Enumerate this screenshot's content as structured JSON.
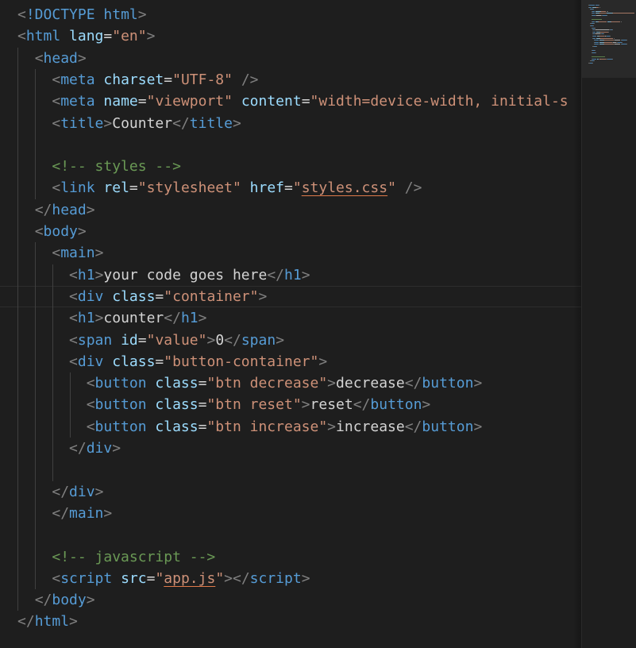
{
  "editor": {
    "language": "html",
    "lines": [
      [
        [
          "punct",
          "<"
        ],
        [
          "doctype",
          "!DOCTYPE"
        ],
        [
          "text",
          " "
        ],
        [
          "tag",
          "html"
        ],
        [
          "punct",
          ">"
        ]
      ],
      [
        [
          "punct",
          "<"
        ],
        [
          "tag",
          "html"
        ],
        [
          "text",
          " "
        ],
        [
          "attr",
          "lang"
        ],
        [
          "text",
          "="
        ],
        [
          "str",
          "\"en\""
        ],
        [
          "punct",
          ">"
        ]
      ],
      [
        [
          "text",
          "  "
        ],
        [
          "punct",
          "<"
        ],
        [
          "tag",
          "head"
        ],
        [
          "punct",
          ">"
        ]
      ],
      [
        [
          "text",
          "    "
        ],
        [
          "punct",
          "<"
        ],
        [
          "tag",
          "meta"
        ],
        [
          "text",
          " "
        ],
        [
          "attr",
          "charset"
        ],
        [
          "text",
          "="
        ],
        [
          "str",
          "\"UTF-8\""
        ],
        [
          "text",
          " "
        ],
        [
          "punct",
          "/>"
        ]
      ],
      [
        [
          "text",
          "    "
        ],
        [
          "punct",
          "<"
        ],
        [
          "tag",
          "meta"
        ],
        [
          "text",
          " "
        ],
        [
          "attr",
          "name"
        ],
        [
          "text",
          "="
        ],
        [
          "str",
          "\"viewport\""
        ],
        [
          "text",
          " "
        ],
        [
          "attr",
          "content"
        ],
        [
          "text",
          "="
        ],
        [
          "str",
          "\"width=device-width, initial-s"
        ]
      ],
      [
        [
          "text",
          "    "
        ],
        [
          "punct",
          "<"
        ],
        [
          "tag",
          "title"
        ],
        [
          "punct",
          ">"
        ],
        [
          "text",
          "Counter"
        ],
        [
          "punct",
          "</"
        ],
        [
          "tag",
          "title"
        ],
        [
          "punct",
          ">"
        ]
      ],
      [],
      [
        [
          "text",
          "    "
        ],
        [
          "comment",
          "<!-- styles -->"
        ]
      ],
      [
        [
          "text",
          "    "
        ],
        [
          "punct",
          "<"
        ],
        [
          "tag",
          "link"
        ],
        [
          "text",
          " "
        ],
        [
          "attr",
          "rel"
        ],
        [
          "text",
          "="
        ],
        [
          "str",
          "\"stylesheet\""
        ],
        [
          "text",
          " "
        ],
        [
          "attr",
          "href"
        ],
        [
          "text",
          "="
        ],
        [
          "str",
          "\""
        ],
        [
          "strlink",
          "styles.css"
        ],
        [
          "str",
          "\""
        ],
        [
          "text",
          " "
        ],
        [
          "punct",
          "/>"
        ]
      ],
      [
        [
          "text",
          "  "
        ],
        [
          "punct",
          "</"
        ],
        [
          "tag",
          "head"
        ],
        [
          "punct",
          ">"
        ]
      ],
      [
        [
          "text",
          "  "
        ],
        [
          "punct",
          "<"
        ],
        [
          "tag",
          "body"
        ],
        [
          "punct",
          ">"
        ]
      ],
      [
        [
          "text",
          "    "
        ],
        [
          "punct",
          "<"
        ],
        [
          "tag",
          "main"
        ],
        [
          "punct",
          ">"
        ]
      ],
      [
        [
          "text",
          "      "
        ],
        [
          "punct",
          "<"
        ],
        [
          "tag",
          "h1"
        ],
        [
          "punct",
          ">"
        ],
        [
          "text",
          "your code goes here"
        ],
        [
          "punct",
          "</"
        ],
        [
          "tag",
          "h1"
        ],
        [
          "punct",
          ">"
        ]
      ],
      [
        [
          "text",
          "      "
        ],
        [
          "punct",
          "<"
        ],
        [
          "tag",
          "div"
        ],
        [
          "text",
          " "
        ],
        [
          "attr",
          "class"
        ],
        [
          "text",
          "="
        ],
        [
          "str",
          "\"container\""
        ],
        [
          "punct",
          ">"
        ]
      ],
      [
        [
          "text",
          "      "
        ],
        [
          "punct",
          "<"
        ],
        [
          "tag",
          "h1"
        ],
        [
          "punct",
          ">"
        ],
        [
          "text",
          "counter"
        ],
        [
          "punct",
          "</"
        ],
        [
          "tag",
          "h1"
        ],
        [
          "punct",
          ">"
        ]
      ],
      [
        [
          "text",
          "      "
        ],
        [
          "punct",
          "<"
        ],
        [
          "tag",
          "span"
        ],
        [
          "text",
          " "
        ],
        [
          "attr",
          "id"
        ],
        [
          "text",
          "="
        ],
        [
          "str",
          "\"value\""
        ],
        [
          "punct",
          ">"
        ],
        [
          "text",
          "0"
        ],
        [
          "punct",
          "</"
        ],
        [
          "tag",
          "span"
        ],
        [
          "punct",
          ">"
        ]
      ],
      [
        [
          "text",
          "      "
        ],
        [
          "punct",
          "<"
        ],
        [
          "tag",
          "div"
        ],
        [
          "text",
          " "
        ],
        [
          "attr",
          "class"
        ],
        [
          "text",
          "="
        ],
        [
          "str",
          "\"button-container\""
        ],
        [
          "punct",
          ">"
        ]
      ],
      [
        [
          "text",
          "        "
        ],
        [
          "punct",
          "<"
        ],
        [
          "tag",
          "button"
        ],
        [
          "text",
          " "
        ],
        [
          "attr",
          "class"
        ],
        [
          "text",
          "="
        ],
        [
          "str",
          "\"btn decrease\""
        ],
        [
          "punct",
          ">"
        ],
        [
          "text",
          "decrease"
        ],
        [
          "punct",
          "</"
        ],
        [
          "tag",
          "button"
        ],
        [
          "punct",
          ">"
        ]
      ],
      [
        [
          "text",
          "        "
        ],
        [
          "punct",
          "<"
        ],
        [
          "tag",
          "button"
        ],
        [
          "text",
          " "
        ],
        [
          "attr",
          "class"
        ],
        [
          "text",
          "="
        ],
        [
          "str",
          "\"btn reset\""
        ],
        [
          "punct",
          ">"
        ],
        [
          "text",
          "reset"
        ],
        [
          "punct",
          "</"
        ],
        [
          "tag",
          "button"
        ],
        [
          "punct",
          ">"
        ]
      ],
      [
        [
          "text",
          "        "
        ],
        [
          "punct",
          "<"
        ],
        [
          "tag",
          "button"
        ],
        [
          "text",
          " "
        ],
        [
          "attr",
          "class"
        ],
        [
          "text",
          "="
        ],
        [
          "str",
          "\"btn increase\""
        ],
        [
          "punct",
          ">"
        ],
        [
          "text",
          "increase"
        ],
        [
          "punct",
          "</"
        ],
        [
          "tag",
          "button"
        ],
        [
          "punct",
          ">"
        ]
      ],
      [
        [
          "text",
          "      "
        ],
        [
          "punct",
          "</"
        ],
        [
          "tag",
          "div"
        ],
        [
          "punct",
          ">"
        ]
      ],
      [],
      [
        [
          "text",
          "    "
        ],
        [
          "punct",
          "</"
        ],
        [
          "tag",
          "div"
        ],
        [
          "punct",
          ">"
        ]
      ],
      [
        [
          "text",
          "    "
        ],
        [
          "punct",
          "</"
        ],
        [
          "tag",
          "main"
        ],
        [
          "punct",
          ">"
        ]
      ],
      [],
      [
        [
          "text",
          "    "
        ],
        [
          "comment",
          "<!-- javascript -->"
        ]
      ],
      [
        [
          "text",
          "    "
        ],
        [
          "punct",
          "<"
        ],
        [
          "tag",
          "script"
        ],
        [
          "text",
          " "
        ],
        [
          "attr",
          "src"
        ],
        [
          "text",
          "="
        ],
        [
          "str",
          "\""
        ],
        [
          "strlink",
          "app.js"
        ],
        [
          "str",
          "\""
        ],
        [
          "punct",
          "></"
        ],
        [
          "tag",
          "script"
        ],
        [
          "punct",
          ">"
        ]
      ],
      [
        [
          "text",
          "  "
        ],
        [
          "punct",
          "</"
        ],
        [
          "tag",
          "body"
        ],
        [
          "punct",
          ">"
        ]
      ],
      [
        [
          "punct",
          "</"
        ],
        [
          "tag",
          "html"
        ],
        [
          "punct",
          ">"
        ]
      ]
    ]
  },
  "colors": {
    "background": "#1e1e1e",
    "tag": "#569cd6",
    "attribute": "#9cdcfe",
    "string": "#ce9178",
    "text": "#d4d4d4",
    "comment": "#6a9955",
    "punctuation": "#808080"
  }
}
